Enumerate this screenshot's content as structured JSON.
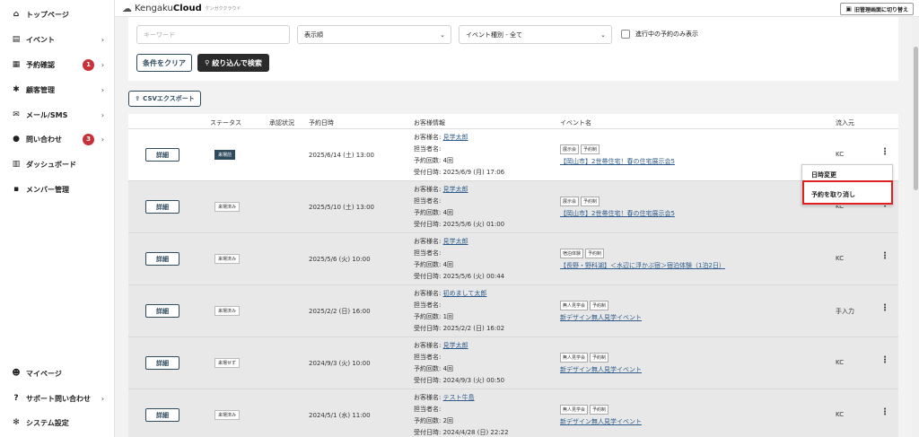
{
  "sidebar": {
    "items": [
      {
        "label": "トップページ",
        "icon": "home-icon",
        "glyph": "⌂"
      },
      {
        "label": "イベント",
        "icon": "document-icon",
        "glyph": "▤"
      },
      {
        "label": "予約確認",
        "icon": "calendar-icon",
        "glyph": "▦",
        "badge": "1"
      },
      {
        "label": "顧客管理",
        "icon": "network-icon",
        "glyph": "✱"
      },
      {
        "label": "メール/SMS",
        "icon": "mail-icon",
        "glyph": "✉"
      },
      {
        "label": "問い合わせ",
        "icon": "chat-icon",
        "glyph": "●",
        "badge": "3"
      },
      {
        "label": "ダッシュボード",
        "icon": "chart-icon",
        "glyph": "▥"
      },
      {
        "label": "メンバー管理",
        "icon": "grid-icon",
        "glyph": "▪"
      }
    ],
    "bottom": [
      {
        "label": "マイページ",
        "icon": "user-icon",
        "glyph": "☻"
      },
      {
        "label": "サポート問い合わせ",
        "icon": "help-icon",
        "glyph": "?"
      },
      {
        "label": "システム設定",
        "icon": "gear-icon",
        "glyph": "✻"
      }
    ]
  },
  "topbar": {
    "brand_a": "Kengaku",
    "brand_b": "Cloud",
    "tagline": "ケンガククラウド",
    "switch_label": "旧管理画面に切り替え"
  },
  "filters": {
    "keyword_placeholder": "キーワード",
    "sort_value": "表示順",
    "event_type_value": "イベント種別 - 全て",
    "ongoing_only_label": "進行中の予約のみ表示",
    "clear_label": "条件をクリア",
    "search_label": "絞り込んで検索"
  },
  "csv_label": "CSVエクスポート",
  "table": {
    "headers": {
      "status": "ステータス",
      "approval": "承認状況",
      "date": "予約日時",
      "customer": "お客様情報",
      "event": "イベント名",
      "source": "流入元"
    },
    "labels": {
      "customer_name": "お客様名:",
      "staff": "担当者名:",
      "count": "予約回数:",
      "received": "受付日時:"
    },
    "detail_label": "詳細",
    "rows": [
      {
        "status": "来場前",
        "date": "2025/6/14 (土) 13:00",
        "customer": "見学太郎",
        "count": "4回",
        "received": "2025/6/9 (月) 17:06",
        "tags": [
          "展示会",
          "予約制"
        ],
        "event": "【岡山市】2世帯住宅！春の住宅展示会5",
        "source": "KC"
      },
      {
        "status": "来場済み",
        "date": "2025/5/10 (土) 13:00",
        "customer": "見学太郎",
        "count": "4回",
        "received": "2025/5/6 (火) 01:00",
        "tags": [
          "展示会",
          "予約制"
        ],
        "event": "【岡山市】2世帯住宅！春の住宅展示会5",
        "source": "KC"
      },
      {
        "status": "来場済み",
        "date": "2025/5/6 (火) 10:00",
        "customer": "見学太郎",
        "count": "4回",
        "received": "2025/5/6 (火) 00:44",
        "tags": [
          "宿泊体験",
          "予約制"
        ],
        "event": "【長野・野科湖】＜水辺に浮かぶ宿＞宿泊体験（1泊2日）",
        "source": "KC"
      },
      {
        "status": "来場済み",
        "date": "2025/2/2 (日) 16:00",
        "customer": "初めまして太郎",
        "count": "1回",
        "received": "2025/2/2 (日) 16:02",
        "tags": [
          "無人見学会",
          "予約制"
        ],
        "event": "新デザイン無人見学イベント",
        "source": "手入力"
      },
      {
        "status": "来場せず",
        "date": "2024/9/3 (火) 10:00",
        "customer": "見学太郎",
        "count": "4回",
        "received": "2024/9/3 (火) 00:50",
        "tags": [
          "無人見学会",
          "予約制"
        ],
        "event": "新デザイン無人見学イベント",
        "source": "KC"
      },
      {
        "status": "来場済み",
        "date": "2024/5/1 (水) 11:00",
        "customer": "テスト牛島",
        "count": "2回",
        "received": "2024/4/28 (日) 22:22",
        "tags": [
          "無人見学会",
          "予約制"
        ],
        "event": "新デザイン無人見学イベント",
        "source": "KC"
      }
    ]
  },
  "context_menu": {
    "reschedule": "日時変更",
    "cancel": "予約を取り消し"
  },
  "colors": {
    "accent_dark": "#2f4b5e",
    "badge_red": "#c8313a",
    "highlight_red": "#e02020",
    "link_blue": "#2e5b8a"
  }
}
